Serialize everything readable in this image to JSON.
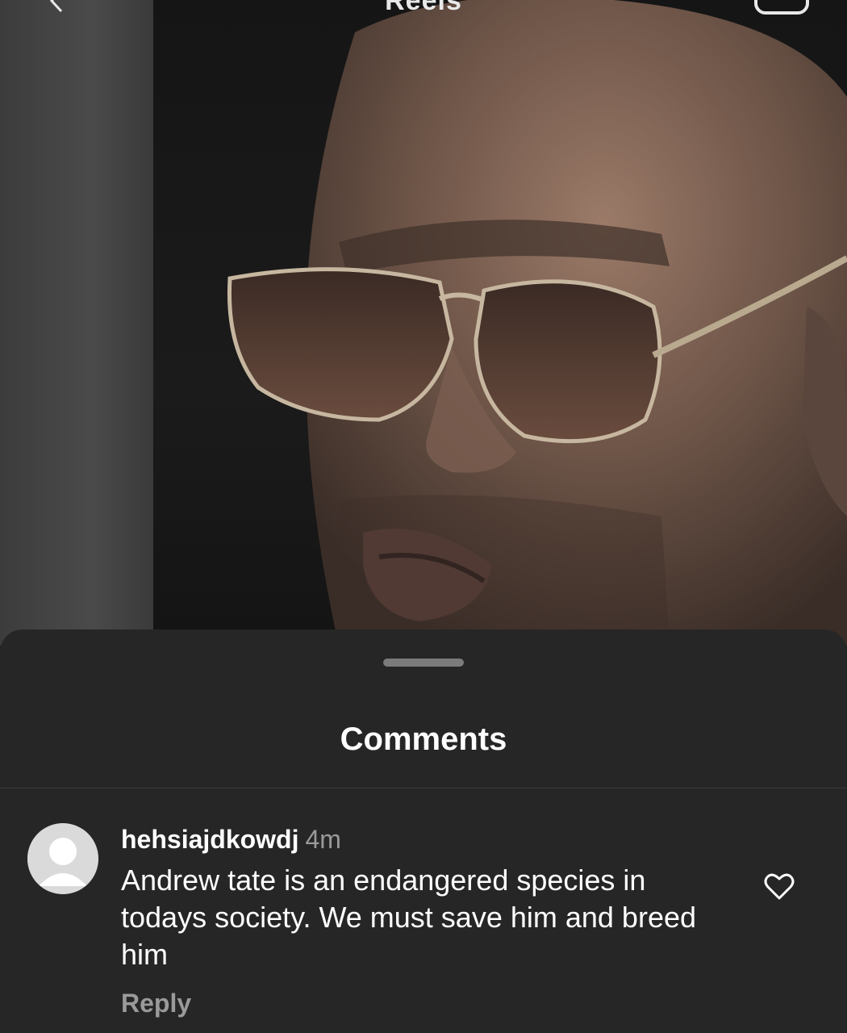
{
  "header": {
    "title": "Reels",
    "back_icon": "chevron-left-icon",
    "camera_icon": "camera-icon"
  },
  "reel": {
    "content": "video-frame"
  },
  "comments_sheet": {
    "title": "Comments",
    "comments": [
      {
        "username": "hehsiajdkowdj",
        "time": "4m",
        "text": "Andrew tate is an endangered species in todays society. We must save him and breed him",
        "reply_label": "Reply",
        "like_icon": "heart-outline-icon"
      }
    ]
  },
  "colors": {
    "sheet_bg": "#262626",
    "text_primary": "#ffffff",
    "text_secondary": "#9a9a9a",
    "handle": "#7b7b7b"
  }
}
